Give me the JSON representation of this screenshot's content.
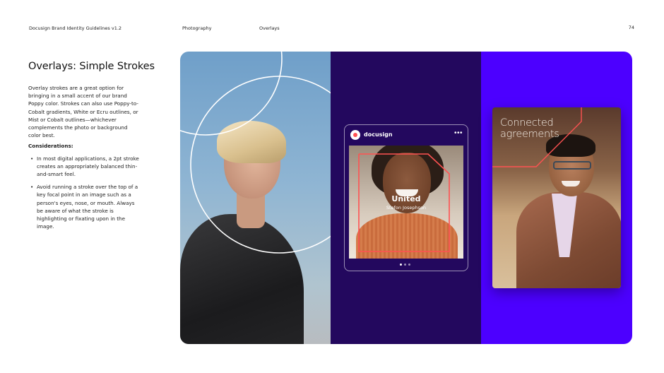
{
  "header": {
    "doc_title": "Docusign Brand Identity Guidelines v1.2",
    "section": "Photography",
    "subsection": "Overlays",
    "page_number": "74"
  },
  "content": {
    "title": "Overlays: Simple Strokes",
    "intro": "Overlay strokes are a great option for bringing in a small accent of our brand Poppy color. Strokes can also use Poppy-to-Cobalt gradients, White or Ecru outlines, or Mist or Cobalt outlines—whichever complements the photo or background color best.",
    "considerations_label": "Considerations:",
    "bullets": [
      "In most digital applications, a 2pt stroke creates an appropriately balanced thin-and-smart feel.",
      "Avoid running a stroke over the top of a key focal point in an image such as a person's eyes, nose, or mouth. Always be aware of what the stroke is highlighting or fixating upon in the image."
    ]
  },
  "examples": {
    "phone": {
      "brand": "docusign",
      "more_icon": "•••",
      "city": "United",
      "person": "Stefon Josephson"
    },
    "card": {
      "title": "Connected agreements"
    }
  },
  "colors": {
    "deep_purple": "#23085e",
    "cobalt": "#4c00ff",
    "poppy": "#ff5252",
    "white": "#ffffff"
  }
}
